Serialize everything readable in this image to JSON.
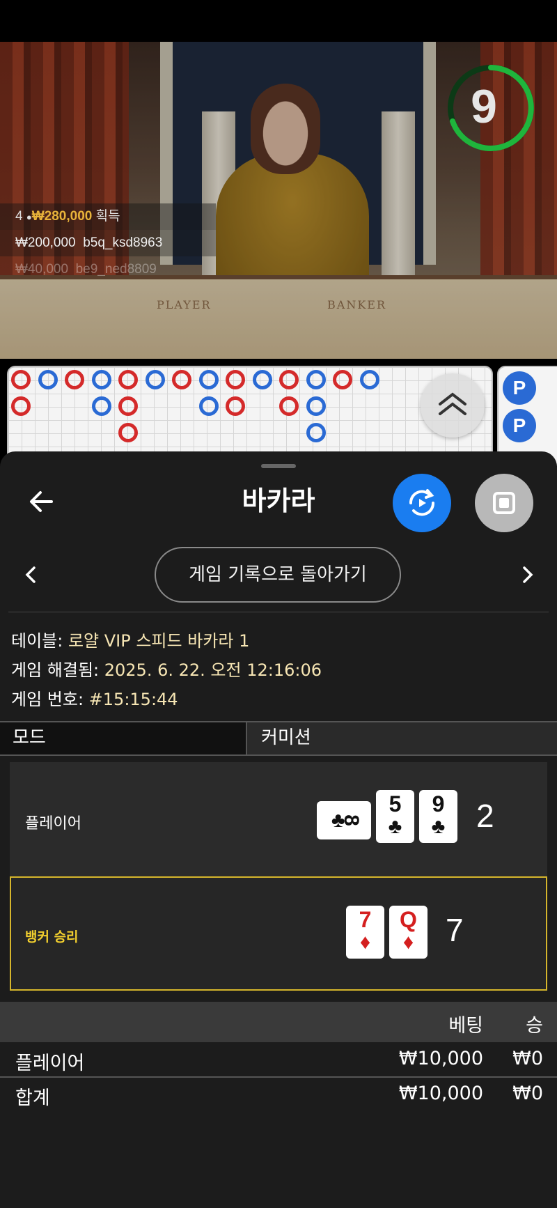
{
  "video": {
    "timer": "9",
    "felt_left": "PLAYER",
    "felt_right": "BANKER",
    "winners": [
      {
        "count": "4",
        "amount": "₩280,000",
        "suffix": "획득"
      },
      {
        "amount": "₩200,000",
        "user": "b5q_ksd8963"
      },
      {
        "amount": "₩40,000",
        "user": "be9_ned8809"
      }
    ]
  },
  "roadmap": {
    "p_badge": "P"
  },
  "sheet": {
    "title": "바카라",
    "history_button": "게임 기록으로 돌아가기",
    "info": [
      {
        "label": "테이블: ",
        "value": "로얄 VIP 스피드 바카라 1"
      },
      {
        "label": "게임 해결됨: ",
        "value": "2025. 6. 22. 오전 12:16:06"
      },
      {
        "label": "게임 번호: ",
        "value": "#15:15:44"
      }
    ],
    "tabs": [
      "모드",
      "커미션"
    ],
    "player": {
      "label": "플레이어",
      "cards": [
        {
          "rank": "8",
          "suit": "♣",
          "color": "black",
          "sideways": true
        },
        {
          "rank": "5",
          "suit": "♣",
          "color": "black"
        },
        {
          "rank": "9",
          "suit": "♣",
          "color": "black"
        }
      ],
      "score": "2"
    },
    "banker": {
      "label": "뱅커 승리",
      "cards": [
        {
          "rank": "7",
          "suit": "♦",
          "color": "red"
        },
        {
          "rank": "Q",
          "suit": "♦",
          "color": "red"
        }
      ],
      "score": "7"
    },
    "bets": {
      "header_bet": "베팅",
      "header_win": "승",
      "rows": [
        {
          "name": "플레이어",
          "bet": "₩10,000",
          "win": "₩0"
        },
        {
          "name": "합계",
          "bet": "₩10,000",
          "win": "₩0"
        }
      ]
    }
  },
  "colors": {
    "accent_blue": "#1a7df0",
    "banker_gold": "#d6b62c",
    "info_value": "#f7e6b4",
    "timer_green": "#1fb53c"
  }
}
